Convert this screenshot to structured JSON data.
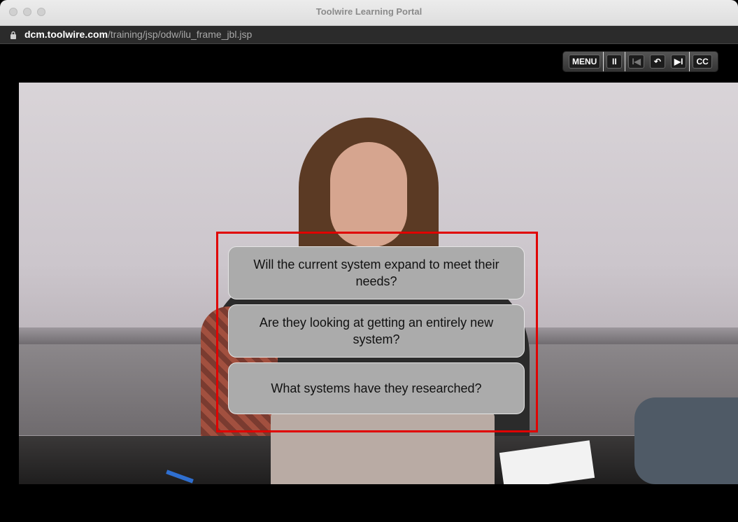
{
  "window": {
    "title": "Toolwire Learning Portal"
  },
  "address_bar": {
    "url_domain": "dcm.toolwire.com",
    "url_path": "/training/jsp/odw/ilu_frame_jbl.jsp"
  },
  "player_controls": {
    "menu_label": "MENU",
    "pause_label": "II",
    "back_label": "I◀",
    "replay_label": "↶",
    "next_label": "▶I",
    "cc_label": "CC"
  },
  "choices": [
    {
      "text": "Will the current system expand to meet their needs?"
    },
    {
      "text": "Are they looking at getting an entirely new system?"
    },
    {
      "text": "What systems have they researched?"
    }
  ],
  "colors": {
    "highlight": "#e00000",
    "choice_bg": "#ababab"
  }
}
